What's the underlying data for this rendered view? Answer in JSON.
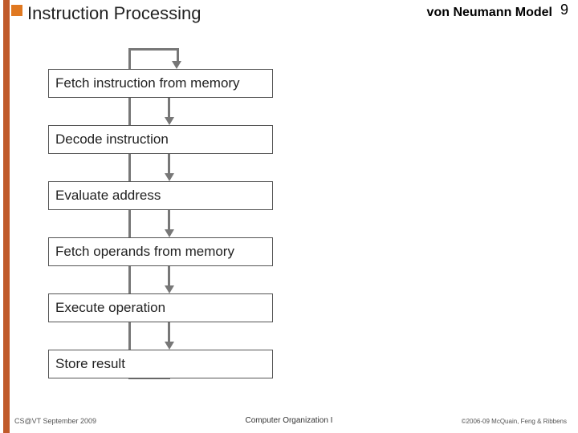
{
  "header": {
    "title": "Instruction Processing",
    "topic": "von Neumann Model",
    "page_number": "9"
  },
  "diagram": {
    "steps": [
      "Fetch instruction from memory",
      "Decode instruction",
      "Evaluate address",
      "Fetch operands from memory",
      "Execute operation",
      "Store result"
    ]
  },
  "footer": {
    "left": "CS@VT September 2009",
    "center": "Computer Organization I",
    "right": "©2006-09  McQuain, Feng & Ribbens"
  },
  "colors": {
    "accent": "#e07820",
    "stripe": "#c05a2a",
    "arrow": "#777"
  }
}
